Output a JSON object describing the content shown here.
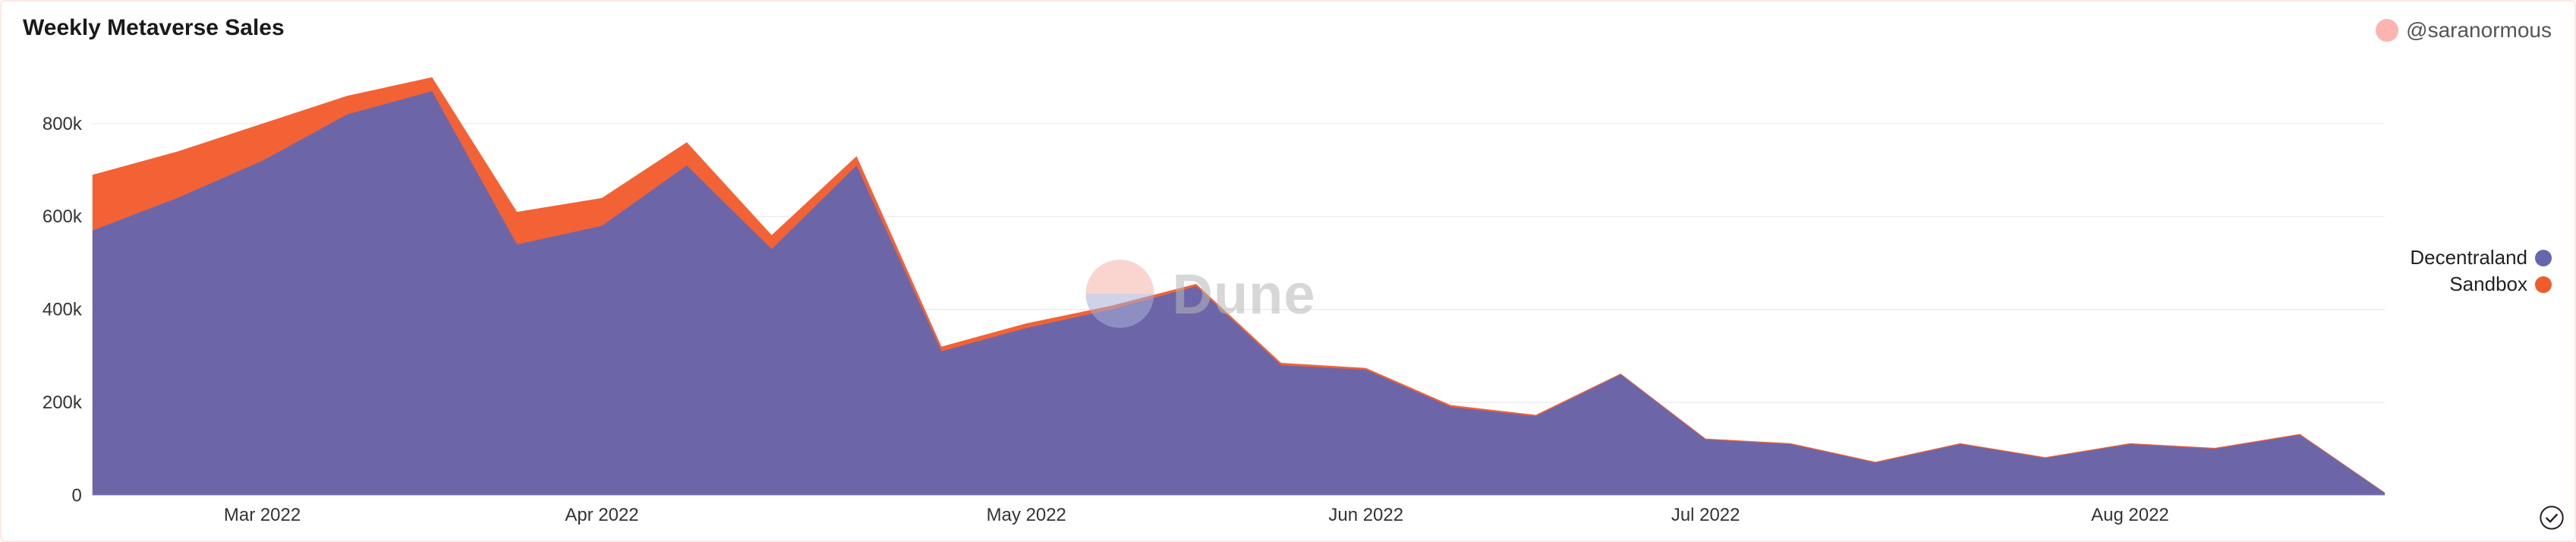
{
  "title": "Weekly Metaverse Sales",
  "author": "@saranormous",
  "watermark": "Dune",
  "legend": [
    {
      "name": "Decentraland",
      "color": "#6466b0"
    },
    {
      "name": "Sandbox",
      "color": "#f15a2a"
    }
  ],
  "colors": {
    "accent_pink": "#fcb4b1",
    "grid": "#e6e6e6",
    "axis": "#333333",
    "border": "#fce8e4"
  },
  "chart_data": {
    "type": "area",
    "stacked": true,
    "title": "Weekly Metaverse Sales",
    "xlabel": "",
    "ylabel": "",
    "ylim": [
      0,
      900000
    ],
    "y_ticks": [
      0,
      200000,
      400000,
      600000,
      800000
    ],
    "y_tick_labels": [
      "0",
      "200k",
      "400k",
      "600k",
      "800k"
    ],
    "x_tick_labels": [
      "Mar 2022",
      "Apr 2022",
      "May 2022",
      "Jun 2022",
      "Jul 2022",
      "Aug 2022"
    ],
    "x_tick_indices": [
      2,
      6,
      11,
      15,
      19,
      24
    ],
    "x": [
      "2022-02-14",
      "2022-02-21",
      "2022-02-28",
      "2022-03-07",
      "2022-03-14",
      "2022-03-21",
      "2022-03-28",
      "2022-04-04",
      "2022-04-11",
      "2022-04-18",
      "2022-04-25",
      "2022-05-02",
      "2022-05-09",
      "2022-05-16",
      "2022-05-23",
      "2022-05-30",
      "2022-06-06",
      "2022-06-13",
      "2022-06-20",
      "2022-06-27",
      "2022-07-04",
      "2022-07-11",
      "2022-07-18",
      "2022-07-25",
      "2022-08-01",
      "2022-08-08",
      "2022-08-15",
      "2022-08-22"
    ],
    "series": [
      {
        "name": "Decentraland",
        "color": "#6466b0",
        "values": [
          570000,
          640000,
          720000,
          820000,
          870000,
          540000,
          580000,
          710000,
          530000,
          710000,
          310000,
          360000,
          400000,
          450000,
          280000,
          270000,
          190000,
          170000,
          260000,
          120000,
          110000,
          70000,
          110000,
          80000,
          110000,
          100000,
          130000,
          5000
        ]
      },
      {
        "name": "Sandbox",
        "color": "#f15a2a",
        "values": [
          120000,
          100000,
          80000,
          40000,
          30000,
          70000,
          60000,
          50000,
          30000,
          20000,
          10000,
          10000,
          8000,
          5000,
          5000,
          4000,
          4000,
          3000,
          2000,
          2000,
          2000,
          2000,
          2000,
          2000,
          2000,
          2000,
          2000,
          1000
        ]
      }
    ]
  }
}
